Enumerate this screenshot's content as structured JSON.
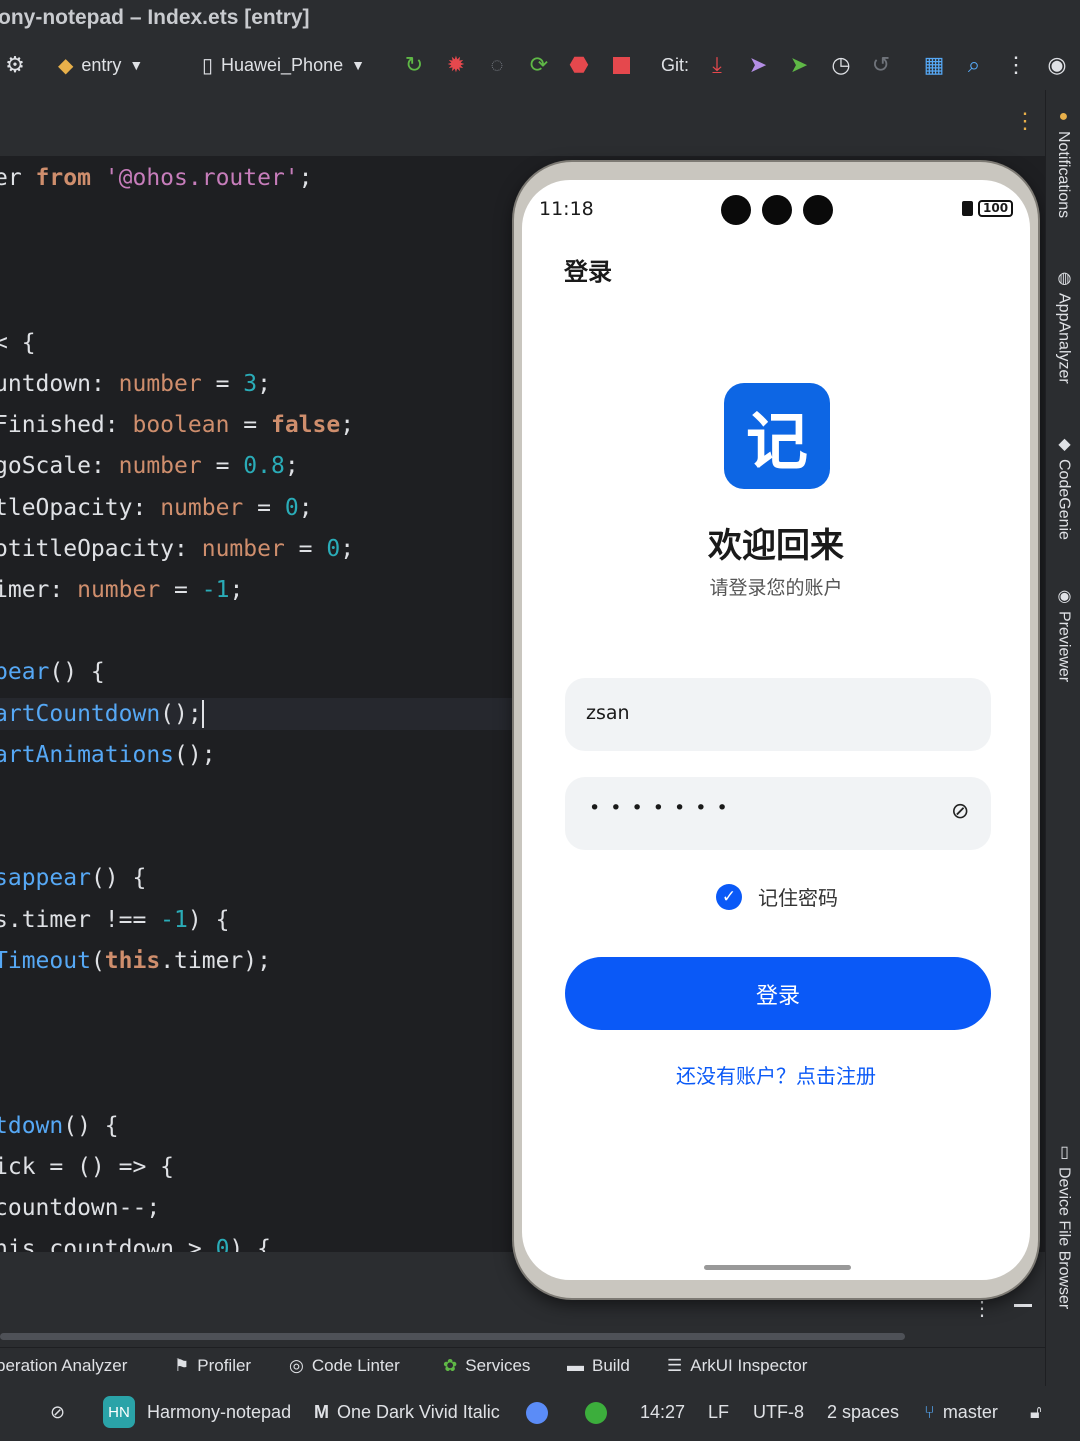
{
  "window": {
    "title": "ony-notepad – Index.ets [entry]"
  },
  "toolbar": {
    "module_select": "entry",
    "device_select": "Huawei_Phone",
    "git_label": "Git:"
  },
  "code_lines": [
    {
      "parts": [
        [
          "er ",
          "plain"
        ],
        [
          "from",
          "kw"
        ],
        [
          " ",
          "plain"
        ],
        [
          "'@ohos.router'",
          "str"
        ],
        [
          ";",
          "plain"
        ]
      ]
    },
    {
      "parts": []
    },
    {
      "parts": []
    },
    {
      "parts": []
    },
    {
      "parts": [
        [
          "< {",
          "plain"
        ]
      ]
    },
    {
      "parts": [
        [
          "untdown",
          "plain"
        ],
        [
          ": ",
          "plain"
        ],
        [
          "number",
          "ty"
        ],
        [
          " = ",
          "plain"
        ],
        [
          "3",
          "num"
        ],
        [
          ";",
          "plain"
        ]
      ]
    },
    {
      "parts": [
        [
          "Finished",
          "plain"
        ],
        [
          ": ",
          "plain"
        ],
        [
          "boolean",
          "ty"
        ],
        [
          " = ",
          "plain"
        ],
        [
          "false",
          "kw"
        ],
        [
          ";",
          "plain"
        ]
      ]
    },
    {
      "parts": [
        [
          "goScale",
          "plain"
        ],
        [
          ": ",
          "plain"
        ],
        [
          "number",
          "ty"
        ],
        [
          " = ",
          "plain"
        ],
        [
          "0.8",
          "num"
        ],
        [
          ";",
          "plain"
        ]
      ]
    },
    {
      "parts": [
        [
          "tleOpacity",
          "plain"
        ],
        [
          ": ",
          "plain"
        ],
        [
          "number",
          "ty"
        ],
        [
          " = ",
          "plain"
        ],
        [
          "0",
          "num"
        ],
        [
          ";",
          "plain"
        ]
      ]
    },
    {
      "parts": [
        [
          "otitleOpacity",
          "plain"
        ],
        [
          ": ",
          "plain"
        ],
        [
          "number",
          "ty"
        ],
        [
          " = ",
          "plain"
        ],
        [
          "0",
          "num"
        ],
        [
          ";",
          "plain"
        ]
      ]
    },
    {
      "parts": [
        [
          "imer",
          "plain"
        ],
        [
          ": ",
          "plain"
        ],
        [
          "number",
          "ty"
        ],
        [
          " = ",
          "plain"
        ],
        [
          "-1",
          "num"
        ],
        [
          ";",
          "plain"
        ]
      ]
    },
    {
      "parts": []
    },
    {
      "parts": [
        [
          "pear",
          "fn"
        ],
        [
          "() {",
          "plain"
        ]
      ]
    },
    {
      "parts": [
        [
          "artCountdown",
          "fn"
        ],
        [
          "();",
          "plain"
        ]
      ],
      "highlight": true
    },
    {
      "parts": [
        [
          "artAnimations",
          "fn"
        ],
        [
          "();",
          "plain"
        ]
      ]
    },
    {
      "parts": []
    },
    {
      "parts": []
    },
    {
      "parts": [
        [
          "sappear",
          "fn"
        ],
        [
          "() {",
          "plain"
        ]
      ]
    },
    {
      "parts": [
        [
          "s.timer !== ",
          "plain"
        ],
        [
          "-1",
          "num"
        ],
        [
          ") {",
          "plain"
        ]
      ]
    },
    {
      "parts": [
        [
          "Timeout",
          "fn"
        ],
        [
          "(",
          "plain"
        ],
        [
          "this",
          "kw"
        ],
        [
          ".timer);",
          "plain"
        ]
      ]
    },
    {
      "parts": []
    },
    {
      "parts": []
    },
    {
      "parts": []
    },
    {
      "parts": [
        [
          "tdown",
          "fn"
        ],
        [
          "() {",
          "plain"
        ]
      ]
    },
    {
      "parts": [
        [
          "ick = () => {",
          "plain"
        ]
      ]
    },
    {
      "parts": [
        [
          "countdown--;",
          "plain"
        ]
      ]
    },
    {
      "parts": [
        [
          "his.countdown > ",
          "plain"
        ],
        [
          "0",
          "num"
        ],
        [
          ") {",
          "plain"
        ]
      ]
    }
  ],
  "phone": {
    "status_time": "11:18",
    "battery": "100",
    "nav_title": "登录",
    "app_icon_char": "记",
    "welcome": "欢迎回来",
    "subtitle": "请登录您的账户",
    "username_value": "zsan",
    "password_value": "• • • • • • •",
    "remember_label": "记住密码",
    "remember_checked": true,
    "login_button": "登录",
    "register_link": "还没有账户？点击注册",
    "accent_color": "#0a59f7"
  },
  "tool_windows": [
    {
      "label": "peration Analyzer",
      "icon": ""
    },
    {
      "label": "Profiler",
      "icon": "profiler-icon"
    },
    {
      "label": "Code Linter",
      "icon": "code-linter-icon"
    },
    {
      "label": "Services",
      "icon": "services-icon"
    },
    {
      "label": "Build",
      "icon": "build-icon"
    },
    {
      "label": "ArkUI Inspector",
      "icon": "arkui-inspector-icon"
    }
  ],
  "right_panel": [
    {
      "label": "Notifications",
      "icon": "bell-icon"
    },
    {
      "label": "AppAnalyzer",
      "icon": "app-analyzer-icon"
    },
    {
      "label": "CodeGenie",
      "icon": "codegenie-icon"
    },
    {
      "label": "Previewer",
      "icon": "eye-icon"
    },
    {
      "label": "Device File Browser",
      "icon": "device-file-browser-icon"
    }
  ],
  "statusbar": {
    "project_badge": "HN",
    "project": "Harmony-notepad",
    "theme": "One Dark Vivid Italic",
    "position": "14:27",
    "line_sep": "LF",
    "encoding": "UTF-8",
    "indent": "2 spaces",
    "branch": "master"
  }
}
